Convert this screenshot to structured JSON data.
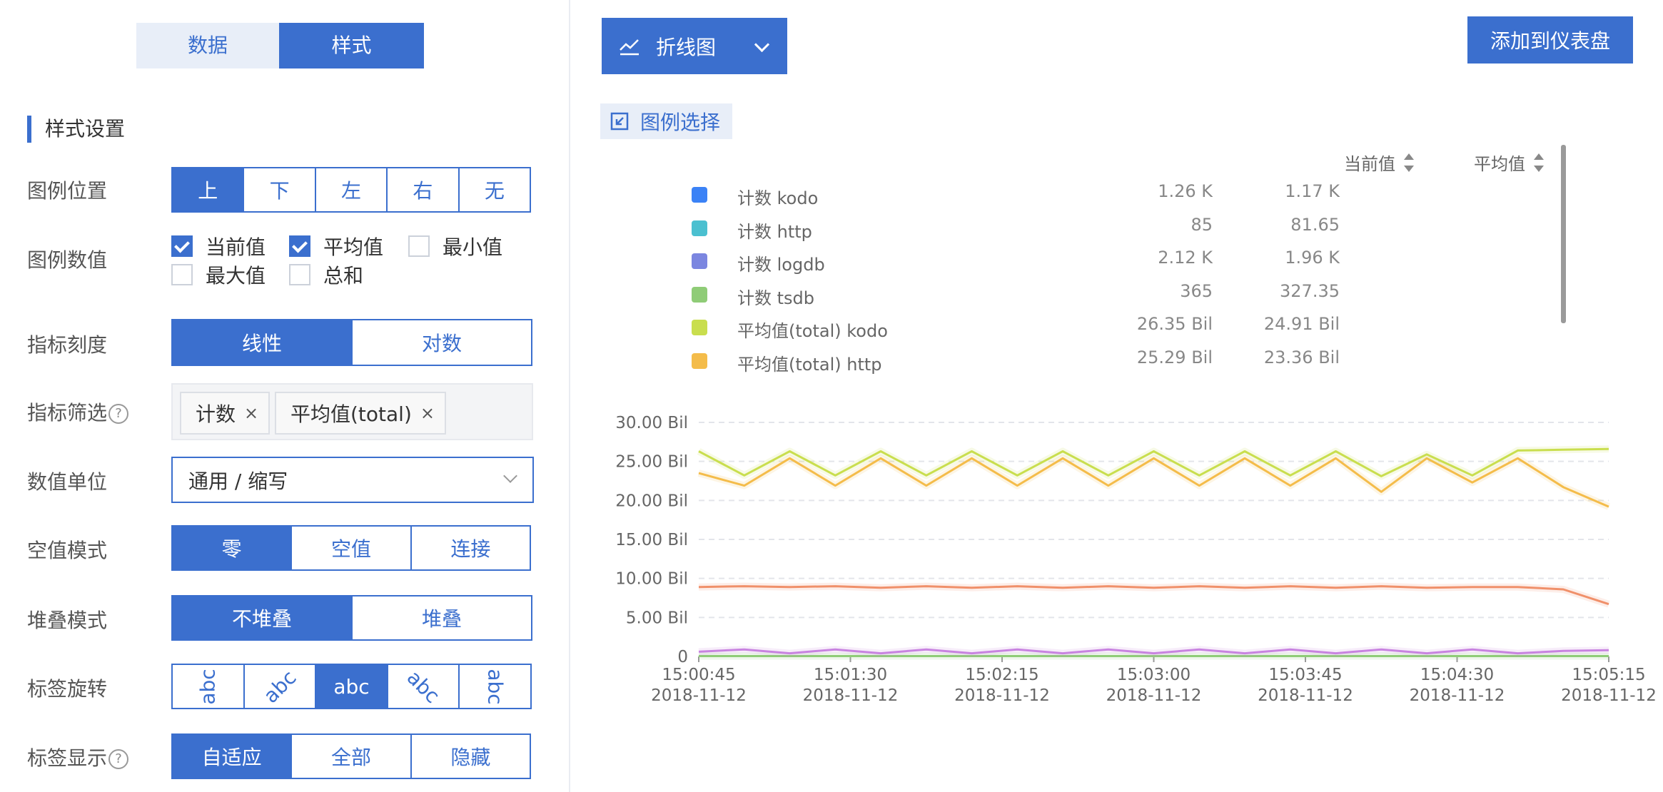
{
  "top_tabs": [
    {
      "label": "数据"
    },
    {
      "label": "样式"
    }
  ],
  "section_title": "样式设置",
  "legend_position": {
    "label": "图例位置",
    "options": [
      "上",
      "下",
      "左",
      "右",
      "无"
    ],
    "selected": "上"
  },
  "legend_values": {
    "label": "图例数值",
    "options": [
      {
        "label": "当前值",
        "checked": true
      },
      {
        "label": "平均值",
        "checked": true
      },
      {
        "label": "最小值",
        "checked": false
      },
      {
        "label": "最大值",
        "checked": false
      },
      {
        "label": "总和",
        "checked": false
      }
    ]
  },
  "metric_scale": {
    "label": "指标刻度",
    "options": [
      "线性",
      "对数"
    ],
    "selected": "线性"
  },
  "metric_filter": {
    "label": "指标筛选",
    "help": "?",
    "tags": [
      "计数",
      "平均值(total)"
    ],
    "remove": "×"
  },
  "value_unit": {
    "label": "数值单位",
    "value": "通用 / 缩写"
  },
  "null_mode": {
    "label": "空值模式",
    "options": [
      "零",
      "空值",
      "连接"
    ],
    "selected": "零"
  },
  "stack_mode": {
    "label": "堆叠模式",
    "options": [
      "不堆叠",
      "堆叠"
    ],
    "selected": "不堆叠"
  },
  "label_rotate": {
    "label": "标签旋转",
    "options": [
      "abc",
      "abc",
      "abc",
      "abc",
      "abc"
    ],
    "selected_index": 2
  },
  "label_display": {
    "label": "标签显示",
    "help": "?",
    "options": [
      "自适应",
      "全部",
      "隐藏"
    ],
    "selected": "自适应"
  },
  "chart_type_select": {
    "label": "折线图",
    "icon": "line-chart-icon"
  },
  "add_button": "添加到仪表盘",
  "legend_select": {
    "label": "图例选择",
    "icon": "legend-select-icon"
  },
  "legend_table": {
    "headers": {
      "current": "当前值",
      "average": "平均值"
    },
    "rows": [
      {
        "name": "计数 kodo",
        "color": "#3b82f6",
        "current": "1.26 K",
        "average": "1.17 K"
      },
      {
        "name": "计数 http",
        "color": "#4bc0d0",
        "current": "85",
        "average": "81.65"
      },
      {
        "name": "计数 logdb",
        "color": "#7b86e0",
        "current": "2.12 K",
        "average": "1.96 K"
      },
      {
        "name": "计数 tsdb",
        "color": "#8fcc77",
        "current": "365",
        "average": "327.35"
      },
      {
        "name": "平均值(total) kodo",
        "color": "#c9de4e",
        "current": "26.35 Bil",
        "average": "24.91 Bil"
      },
      {
        "name": "平均值(total) http",
        "color": "#f4bc4a",
        "current": "25.29 Bil",
        "average": "23.36 Bil"
      }
    ]
  },
  "chart_data": {
    "type": "line",
    "title": "",
    "xlabel": "",
    "ylabel": "",
    "y_ticks": [
      "30.00 Bil",
      "25.00 Bil",
      "20.00 Bil",
      "15.00 Bil",
      "10.00 Bil",
      "5.00 Bil",
      "0"
    ],
    "ylim": [
      0,
      30
    ],
    "y_unit": "Bil",
    "x_ticks": [
      {
        "time": "15:00:45",
        "date": "2018-11-12"
      },
      {
        "time": "15:01:30",
        "date": "2018-11-12"
      },
      {
        "time": "15:02:15",
        "date": "2018-11-12"
      },
      {
        "time": "15:03:00",
        "date": "2018-11-12"
      },
      {
        "time": "15:03:45",
        "date": "2018-11-12"
      },
      {
        "time": "15:04:30",
        "date": "2018-11-12"
      },
      {
        "time": "15:05:15",
        "date": "2018-11-12"
      }
    ],
    "x_points": 21,
    "series": [
      {
        "color": "#c9de4e",
        "values": [
          26.3,
          23.2,
          26.3,
          23.2,
          26.3,
          23.2,
          26.3,
          23.2,
          26.3,
          23.2,
          26.3,
          23.2,
          26.3,
          23.2,
          26.3,
          23.1,
          25.9,
          23.2,
          26.4,
          26.5,
          26.6
        ]
      },
      {
        "color": "#f4bc4a",
        "values": [
          23.5,
          21.9,
          25.4,
          21.9,
          25.4,
          21.9,
          25.4,
          21.9,
          25.4,
          21.9,
          25.4,
          21.9,
          25.4,
          21.9,
          25.4,
          21.1,
          25.4,
          22.3,
          25.4,
          21.7,
          19.2
        ]
      },
      {
        "color": "#f0906a",
        "values": [
          8.9,
          9.0,
          8.9,
          9.0,
          8.8,
          9.0,
          8.8,
          9.0,
          8.8,
          9.0,
          8.8,
          9.0,
          8.8,
          9.0,
          8.8,
          9.0,
          8.8,
          8.9,
          8.9,
          8.6,
          6.7
        ]
      },
      {
        "color": "#c883e0",
        "values": [
          0.6,
          0.9,
          0.4,
          0.9,
          0.4,
          0.9,
          0.4,
          0.9,
          0.4,
          0.9,
          0.4,
          0.9,
          0.4,
          0.9,
          0.4,
          0.9,
          0.4,
          0.9,
          0.4,
          0.7,
          0.8
        ]
      },
      {
        "color": "#8fcc77",
        "values": [
          0.05,
          0.05,
          0.05,
          0.05,
          0.05,
          0.05,
          0.05,
          0.05,
          0.05,
          0.05,
          0.05,
          0.05,
          0.05,
          0.05,
          0.05,
          0.05,
          0.05,
          0.05,
          0.05,
          0.05,
          0.05
        ]
      }
    ]
  }
}
